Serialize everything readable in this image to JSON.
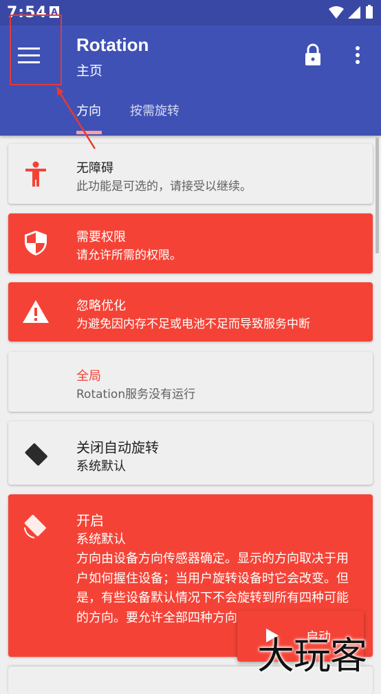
{
  "status_bar": {
    "time": "7:54",
    "notification_glyph": "A"
  },
  "app": {
    "title": "Rotation",
    "subtitle": "主页"
  },
  "tabs": [
    {
      "label": "方向"
    },
    {
      "label": "按需旋转"
    }
  ],
  "cards": {
    "accessibility": {
      "title": "无障碍",
      "subtitle": "此功能是可选的，请接受以继续。",
      "icon": "accessibility-icon"
    },
    "permission": {
      "title": "需要权限",
      "subtitle": "请允许所需的权限。",
      "icon": "security-shield-icon"
    },
    "battery": {
      "title": "忽略优化",
      "subtitle": "为避免因内存不足或电池不足而导致服务中断",
      "icon": "warning-icon"
    },
    "global": {
      "title": "全局",
      "subtitle": "Rotation服务没有运行"
    },
    "auto_rotate_off": {
      "title": "关闭自动旋转",
      "subtitle": "系统默认",
      "icon": "screen-rotation-lock-icon"
    },
    "on": {
      "title": "开启",
      "subtitle": "系统默认",
      "icon": "screen-rotation-icon",
      "description": "方向由设备方向传感器确定。显示的方向取决于用户如何握住设备；当用户旋转设备时它会改变。但是，有些设备默认情况下不会旋转到所有四种可能的方向。要允许全部四种方向，请使用Full传感器。"
    }
  },
  "fab": {
    "label": "启动",
    "icon": "play-icon"
  },
  "watermark": "大玩客",
  "colors": {
    "primary": "#3f51b5",
    "status_bar": "#3a48a5",
    "accent_red": "#f44336",
    "card_light": "#efefef",
    "annotation": "#e53935"
  }
}
